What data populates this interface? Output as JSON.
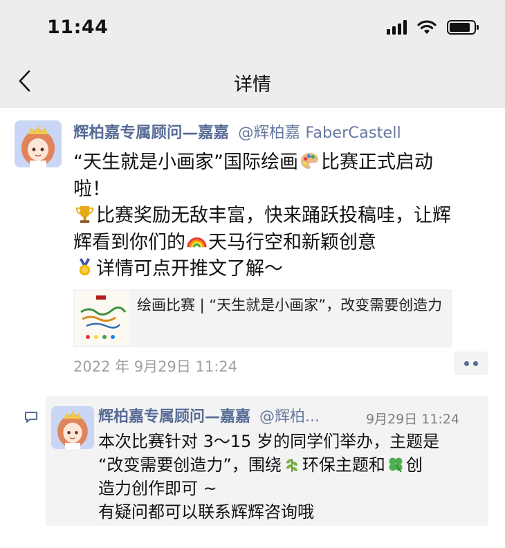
{
  "status": {
    "time": "11:44"
  },
  "nav": {
    "title": "详情"
  },
  "post": {
    "author_name": "辉柏嘉专属顾问—嘉嘉",
    "author_handle": "@辉柏嘉 FaberCastell",
    "lines": {
      "l1a": "“天生就是小画家”国际绘画",
      "l1b": "比赛正式启动",
      "l2": "啦！",
      "l3": "比赛奖励无敌丰富，快来踊跃投稿哇，让辉",
      "l4a": "辉看到你们的",
      "l4b": "天马行空和新颖创意",
      "l5": "详情可点开推文了解～"
    },
    "share_card": {
      "title": "绘画比赛 | “天生就是小画家”，改变需要创造力"
    },
    "timestamp": "2022 年 9月29日 11:24"
  },
  "comment": {
    "author_name": "辉柏嘉专属顾问—嘉嘉",
    "author_handle": "@辉柏...",
    "time": "9月29日 11:24",
    "lines": {
      "l1": "本次比赛针对 3～15 岁的同学们举办，主题是",
      "l2a": "“改变需要创造力”，围绕",
      "l2b": "环保主题和",
      "l2c": "创",
      "l3": "造力创作即可 ~",
      "l4": "有疑问都可以联系辉辉咨询哦"
    }
  },
  "icons": {
    "back": "chevron-left-icon",
    "signal": "signal-icon",
    "wifi": "wifi-icon",
    "battery": "battery-icon",
    "palette": "palette-emoji-icon",
    "trophy": "trophy-emoji-icon",
    "rainbow": "rainbow-emoji-icon",
    "medal": "medal-emoji-icon",
    "herb": "herb-emoji-icon",
    "clover": "clover-emoji-icon",
    "comment": "comment-icon",
    "more": "more-dots-icon"
  },
  "colors": {
    "header_bg": "#ededed",
    "link": "#576b95",
    "timestamp": "#a0a0a0",
    "card_bg": "#f3f3f3"
  },
  "battery_level": 0.85
}
